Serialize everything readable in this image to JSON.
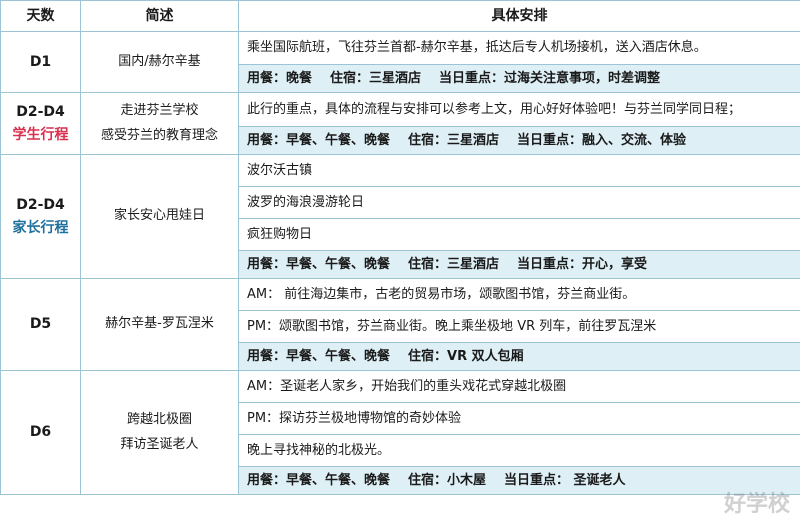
{
  "header": {
    "day": "天数",
    "summary": "简述",
    "detail": "具体安排"
  },
  "colors": {
    "student_tag": "#d9304f",
    "parent_tag": "#1f6f9c",
    "meal_bg": "#def0f6",
    "border": "#9cc4d4"
  },
  "rows": {
    "d1": {
      "day": "D1",
      "summary": "国内/赫尔辛基",
      "plans": [
        "乘坐国际航班，飞往芬兰首都-赫尔辛基，抵达后专人机场接机，送入酒店休息。"
      ],
      "meal": "用餐：晚餐",
      "stay": "住宿：三星酒店",
      "focus": "当日重点：过海关注意事项，时差调整"
    },
    "d2s": {
      "day": "D2-D4",
      "tag": "学生行程",
      "summary1": "走进芬兰学校",
      "summary2": "感受芬兰的教育理念",
      "plans": [
        "此行的重点，具体的流程与安排可以参考上文，用心好好体验吧！与芬兰同学同日程；"
      ],
      "meal": "用餐：早餐、午餐、晚餐",
      "stay": "住宿：三星酒店",
      "focus": "当日重点：融入、交流、体验"
    },
    "d2p": {
      "day": "D2-D4",
      "tag": "家长行程",
      "summary": "家长安心甩娃日",
      "plans": [
        "波尔沃古镇",
        "波罗的海浪漫游轮日",
        "疯狂购物日"
      ],
      "meal": "用餐：早餐、午餐、晚餐",
      "stay": "住宿：三星酒店",
      "focus": "当日重点：开心，享受"
    },
    "d5": {
      "day": "D5",
      "summary": "赫尔辛基-罗瓦涅米",
      "plans": [
        "AM： 前往海边集市，古老的贸易市场，颂歌图书馆，芬兰商业街。",
        "PM：颂歌图书馆，芬兰商业街。晚上乘坐极地 VR 列车，前往罗瓦涅米"
      ],
      "meal": "用餐：早餐、午餐、晚餐",
      "stay": "住宿：VR 双人包厢"
    },
    "d6": {
      "day": "D6",
      "summary1": "跨越北极圈",
      "summary2": "拜访圣诞老人",
      "plans": [
        "AM：圣诞老人家乡，开始我们的重头戏花式穿越北极圈",
        "PM：探访芬兰极地博物馆的奇妙体验",
        "晚上寻找神秘的北极光。"
      ],
      "meal": "用餐：早餐、午餐、晚餐",
      "stay": "住宿：小木屋",
      "focus": "当日重点： 圣诞老人"
    }
  },
  "watermark": "好学校"
}
